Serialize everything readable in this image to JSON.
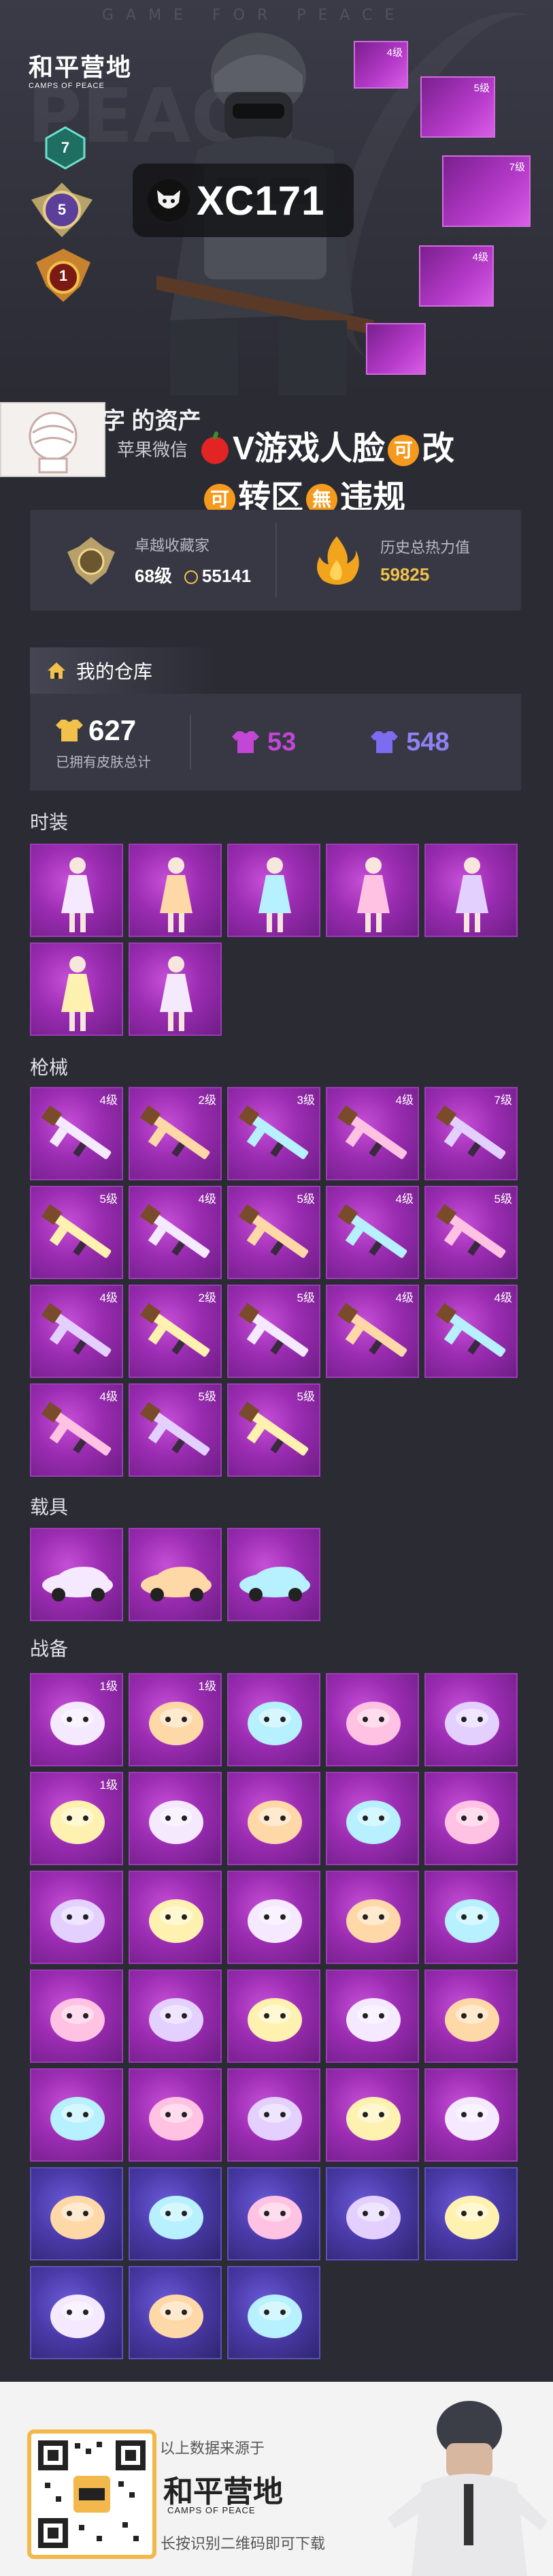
{
  "hero": {
    "watermark": "GAME FOR PEACE",
    "bg_text": "PEACE",
    "logo_cn": "和平营地",
    "logo_en": "CAMPS OF PEACE",
    "player_name": "XC171",
    "rank_badges": [
      "7",
      "5",
      "1"
    ],
    "showcase_levels": [
      "4级",
      "5级",
      "7级",
      "4级"
    ]
  },
  "owner": {
    "title": "字 的资产",
    "subtitle": "苹果微信",
    "promo_line1_a": "V游戏人脸",
    "promo_badge_1": "可",
    "promo_line1_b": "改",
    "promo_badge_2": "可",
    "promo_line2_a": "转区",
    "promo_badge_3": "無",
    "promo_line2_b": "违规"
  },
  "stats": {
    "collector_label": "卓越收藏家",
    "collector_level": "68级",
    "collector_points": "55141",
    "power_label": "历史总热力值",
    "power_value": "59825"
  },
  "warehouse": {
    "title": "我的仓库",
    "total": "627",
    "total_caption": "已拥有皮肤总计",
    "purple_count": "53",
    "blue_count": "548"
  },
  "sections": {
    "fashion": "时装",
    "guns": "枪械",
    "vehicles": "载具",
    "gear": "战备"
  },
  "gun_levels": [
    "4级",
    "2级",
    "3级",
    "4级",
    "7级",
    "5级",
    "4级",
    "5级",
    "4级",
    "5级",
    "4级",
    "2级",
    "5级",
    "4级",
    "4级",
    "4级",
    "5级",
    "5级"
  ],
  "gear_levels": [
    "1级",
    "1级",
    "",
    "",
    "",
    "1级"
  ],
  "colors": {
    "tile_purple": "#9a2cb1",
    "tile_blue": "#4a3aa8",
    "gold": "#f2c14b",
    "badge_orange": "#f59a1c"
  },
  "footer": {
    "source": "以上数据来源于",
    "logo_cn": "和平营地",
    "logo_en": "CAMPS OF PEACE",
    "hint": "长按识别二维码即可下载"
  }
}
